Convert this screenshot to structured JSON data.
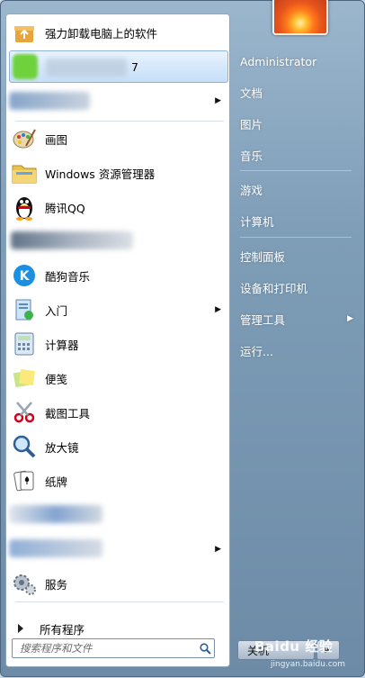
{
  "left_panel": {
    "items": [
      {
        "label": "强力卸载电脑上的软件",
        "icon": "uninstall-box-icon"
      },
      {
        "label": "7",
        "icon": "blurred-app-icon",
        "highlighted": true
      },
      {
        "label": "",
        "icon": "blurred-app-icon",
        "has_submenu": true
      },
      {
        "label": "画图",
        "icon": "paint-palette-icon"
      },
      {
        "label": "Windows 资源管理器",
        "icon": "folder-explorer-icon"
      },
      {
        "label": "腾讯QQ",
        "icon": "qq-penguin-icon"
      },
      {
        "label": "",
        "icon": "blurred-app-icon"
      },
      {
        "label": "酷狗音乐",
        "icon": "kugou-k-icon"
      },
      {
        "label": "入门",
        "icon": "getting-started-icon",
        "has_submenu": true
      },
      {
        "label": "计算器",
        "icon": "calculator-icon"
      },
      {
        "label": "便笺",
        "icon": "sticky-notes-icon"
      },
      {
        "label": "截图工具",
        "icon": "scissors-icon"
      },
      {
        "label": "放大镜",
        "icon": "magnifier-icon"
      },
      {
        "label": "纸牌",
        "icon": "solitaire-cards-icon"
      },
      {
        "label": "",
        "icon": "blurred-app-icon"
      },
      {
        "label": "",
        "icon": "blurred-app-icon",
        "has_submenu": true
      },
      {
        "label": "服务",
        "icon": "services-gear-icon"
      }
    ],
    "all_programs": "所有程序",
    "search_placeholder": "搜索程序和文件"
  },
  "right_panel": {
    "user": "Administrator",
    "items": [
      {
        "label": "文档"
      },
      {
        "label": "图片"
      },
      {
        "label": "音乐"
      },
      {
        "label": "游戏"
      },
      {
        "label": "计算机"
      },
      {
        "label": "控制面板"
      },
      {
        "label": "设备和打印机"
      },
      {
        "label": "管理工具",
        "has_submenu": true
      },
      {
        "label": "运行..."
      }
    ],
    "shutdown": "关机"
  },
  "watermark": {
    "text": "Baidu 经验",
    "sub": "jingyan.baidu.com"
  },
  "colors": {
    "accent_highlight": "#cfe3f8",
    "right_panel_bg": "#7e9db7"
  }
}
